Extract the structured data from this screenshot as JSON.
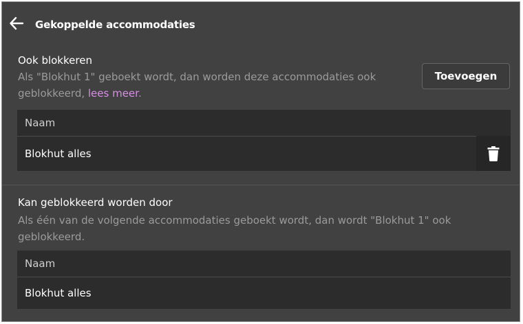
{
  "header": {
    "title": "Gekoppelde accommodaties"
  },
  "block_section": {
    "title": "Ook blokkeren",
    "description": "Als \"Blokhut 1\" geboekt wordt, dan worden deze accommodaties ook geblokkeerd, ",
    "link_text": "lees meer",
    "link_suffix": ".",
    "add_button": "Toevoegen",
    "table": {
      "column": "Naam",
      "rows": [
        "Blokhut alles"
      ]
    }
  },
  "blocked_by_section": {
    "title": "Kan geblokkeerd worden door",
    "description": "Als één van de volgende accommodaties geboekt wordt, dan wordt \"Blokhut 1\" ook geblokkeerd.",
    "table": {
      "column": "Naam",
      "rows": [
        "Blokhut alles"
      ]
    }
  },
  "icons": {
    "back": "arrow-left-icon",
    "delete": "trash-icon"
  },
  "colors": {
    "background": "#414141",
    "table": "#2c2c2c",
    "link": "#d88ee6"
  }
}
